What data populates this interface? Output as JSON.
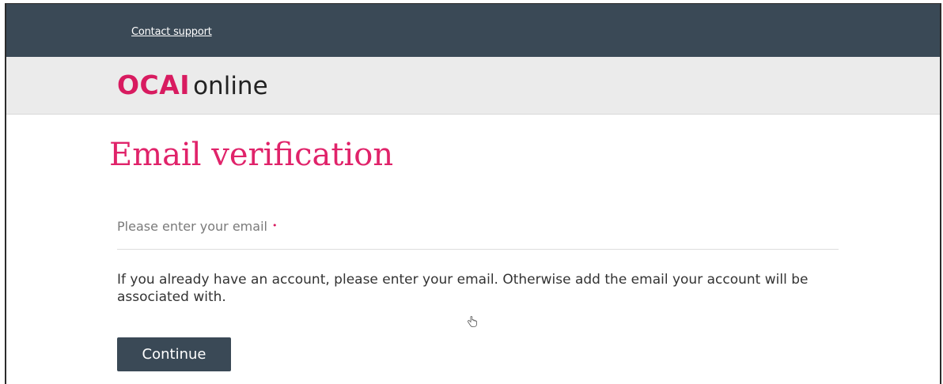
{
  "topbar": {
    "support_link": "Contact support"
  },
  "brand": {
    "logo_strong": "OCAI",
    "logo_light": "online",
    "accent_color": "#d81b60",
    "bar_color": "#3a4956"
  },
  "page": {
    "title": "Email verification"
  },
  "form": {
    "email_label": "Please enter your email",
    "required_mark": "•",
    "help_text": "If you already have an account, please enter your email. Otherwise add the email your account will be associated with.",
    "continue_label": "Continue"
  },
  "icons": {
    "cursor": "hand-pointer-icon"
  }
}
